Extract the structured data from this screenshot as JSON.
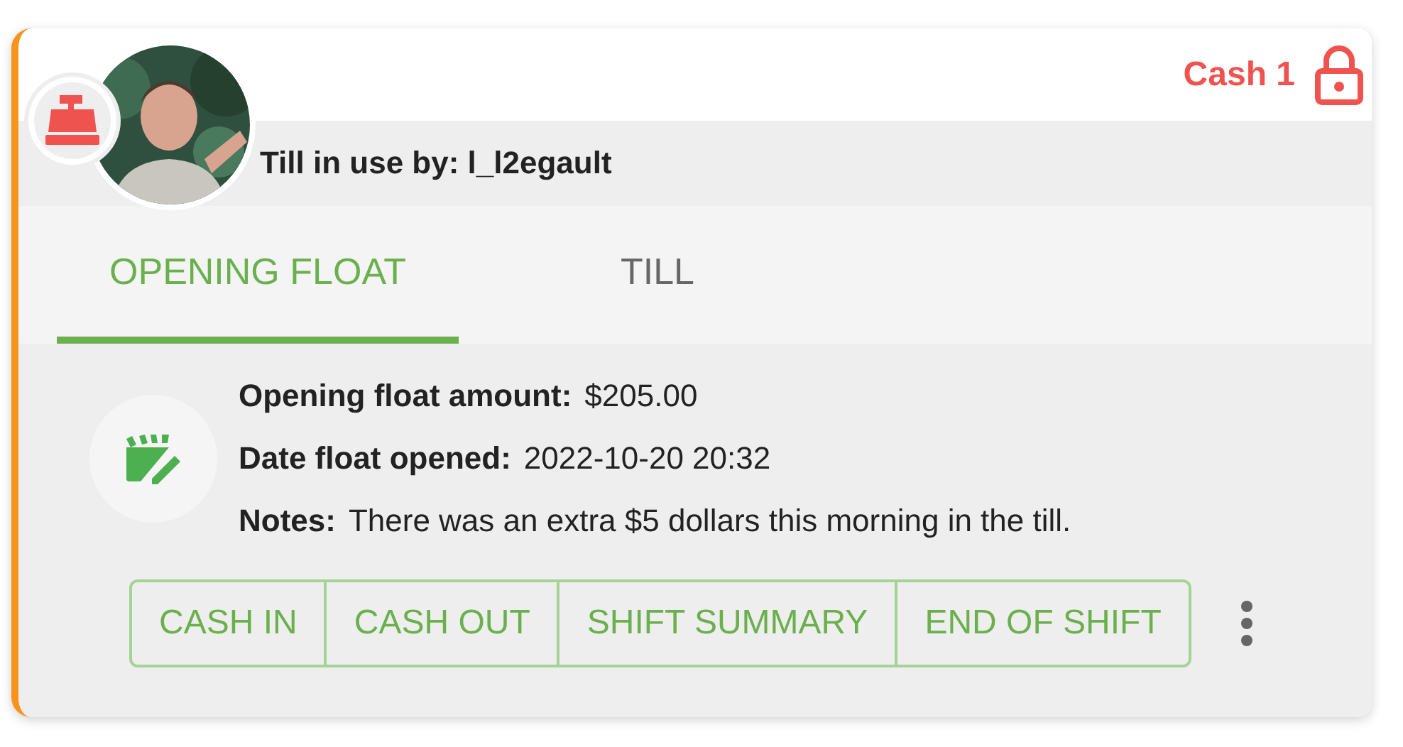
{
  "card": {
    "register_name": "Cash 1",
    "user_label": "Till in use by: l_l2egault"
  },
  "tabs": [
    {
      "label": "OPENING FLOAT",
      "selected": true
    },
    {
      "label": "TILL",
      "selected": false
    }
  ],
  "details": [
    {
      "label": "Opening float amount:",
      "value": "$205.00"
    },
    {
      "label": "Date float opened:",
      "value": "2022-10-20 20:32"
    },
    {
      "label": "Notes:",
      "value": "There was an extra $5 dollars this morning in the till."
    }
  ],
  "actions": [
    "CASH IN",
    "CASH OUT",
    "SHIFT SUMMARY",
    "END OF SHIFT"
  ]
}
